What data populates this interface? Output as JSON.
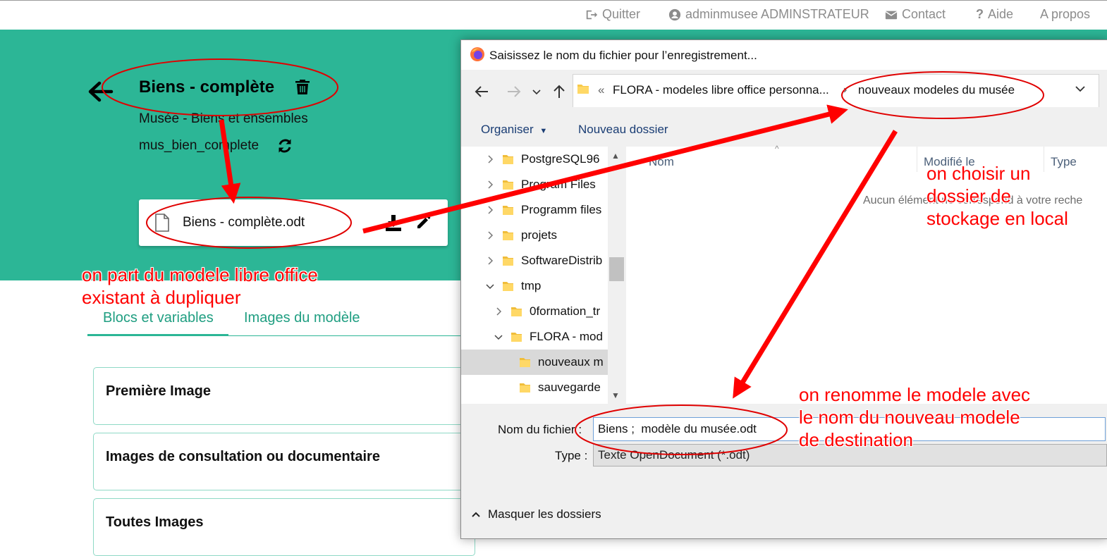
{
  "topbar": {
    "quit": "Quitter",
    "user": "adminmusee ADMINSTRATEUR",
    "contact": "Contact",
    "help": "Aide",
    "about": "A propos"
  },
  "model": {
    "title": "Biens - complète",
    "subtitle": "Musée - Biens et ensembles",
    "code": "mus_bien_complete",
    "file_name": "Biens - complète.odt"
  },
  "tabs": [
    {
      "label": "Blocs et variables",
      "active": true
    },
    {
      "label": "Images du modèle",
      "active": false
    }
  ],
  "blocks": [
    {
      "title": "Première Image"
    },
    {
      "title": "Images de consultation ou documentaire"
    },
    {
      "title": "Toutes Images"
    }
  ],
  "dialog": {
    "title": "Saisissez le nom du fichier pour l’enregistrement...",
    "address": {
      "overflow": "«",
      "path1": "FLORA - modeles libre office personna...",
      "path2": "nouveaux modeles du musée"
    },
    "toolbar": {
      "organise": "Organiser",
      "new_folder": "Nouveau dossier"
    },
    "tree": [
      {
        "label": "PostgreSQL96",
        "expanded": false,
        "level": 0
      },
      {
        "label": "Program Files",
        "expanded": false,
        "level": 0
      },
      {
        "label": "Programm files",
        "expanded": false,
        "level": 0
      },
      {
        "label": "projets",
        "expanded": false,
        "level": 0
      },
      {
        "label": "SoftwareDistrib",
        "expanded": false,
        "level": 0
      },
      {
        "label": "tmp",
        "expanded": true,
        "level": 0
      },
      {
        "label": "0formation_tr",
        "expanded": false,
        "level": 1
      },
      {
        "label": "FLORA - mod",
        "expanded": true,
        "level": 1
      },
      {
        "label": "nouveaux m",
        "selected": true,
        "level": 2
      },
      {
        "label": "sauvegarde",
        "level": 2
      }
    ],
    "columns": [
      "Nom",
      "Modifié le",
      "Type"
    ],
    "empty_message": "Aucun élément ne correspond à votre reche",
    "filename_label": "Nom du fichier :",
    "filename_value": "Biens ;  modèle du musée.odt",
    "type_label": "Type :",
    "type_value": "Texte OpenDocument (*.odt)",
    "hide_folders": "Masquer les dossiers"
  },
  "annotations": {
    "note_source": [
      "on part du modele libre office",
      "existant à dupliquer"
    ],
    "note_folder": [
      "on choisir un",
      "dossier de",
      "stockage en local"
    ],
    "note_rename": [
      "on renomme le modele avec",
      "le nom du nouveau modele",
      "de destination"
    ],
    "color": "#ff0000"
  },
  "colors": {
    "brand_green": "#2cb696",
    "tab_text": "#1f9e81"
  }
}
